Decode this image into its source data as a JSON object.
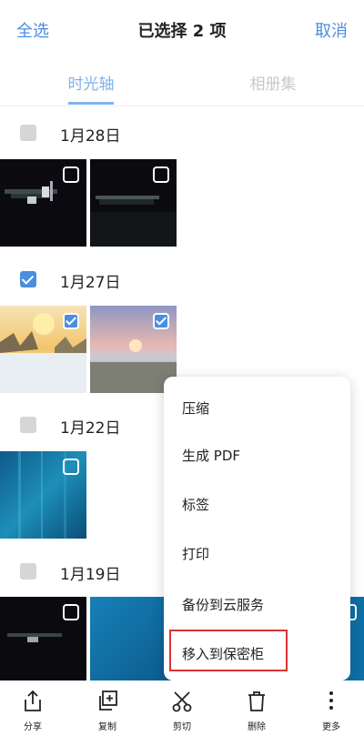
{
  "header": {
    "select_all": "全选",
    "title": "已选择 2 项",
    "cancel": "取消"
  },
  "tabs": [
    {
      "label": "时光轴",
      "active": true
    },
    {
      "label": "相册集",
      "active": false
    }
  ],
  "groups": [
    {
      "date": "1月28日",
      "checked": false
    },
    {
      "date": "1月27日",
      "checked": true
    },
    {
      "date": "1月22日",
      "checked": false
    },
    {
      "date": "1月19日",
      "checked": false
    }
  ],
  "menu": {
    "items": [
      "压缩",
      "生成 PDF",
      "标签",
      "打印",
      "备份到云服务",
      "移入到保密柜"
    ],
    "highlighted": "移入到保密柜"
  },
  "toolbar": {
    "items": [
      {
        "label": "分享",
        "icon": "share-icon"
      },
      {
        "label": "复制",
        "icon": "copy-icon"
      },
      {
        "label": "剪切",
        "icon": "scissors-icon"
      },
      {
        "label": "删除",
        "icon": "trash-icon"
      },
      {
        "label": "更多",
        "icon": "more-vertical-icon"
      }
    ]
  },
  "colors": {
    "accent": "#4a8ee0",
    "highlight_border": "#dd3333"
  }
}
